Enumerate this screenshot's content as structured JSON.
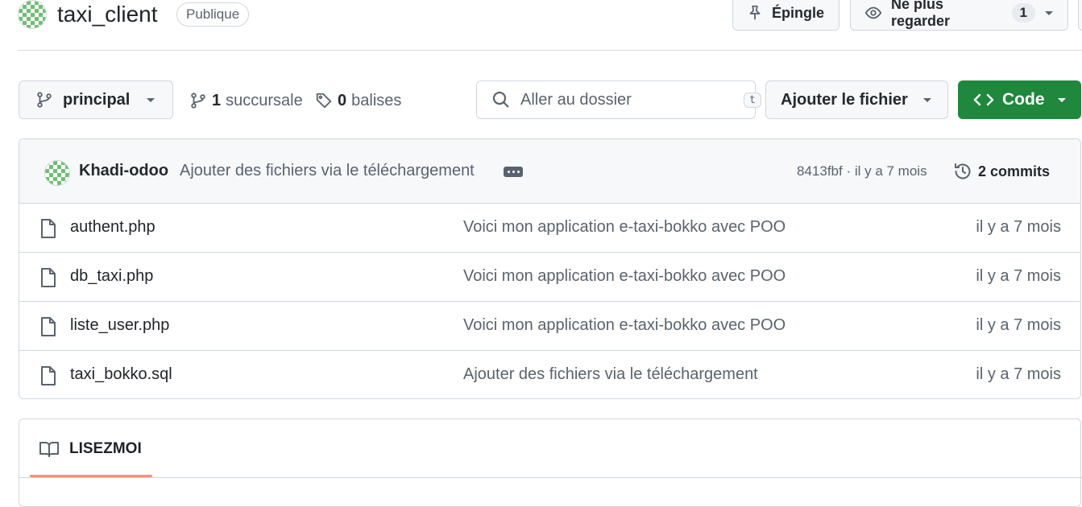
{
  "repo": {
    "name": "taxi_client",
    "visibility": "Publique"
  },
  "actions": {
    "pin_label": "Épingle",
    "watch_label": "Ne plus regarder",
    "watch_count": "1"
  },
  "toolbar": {
    "branch": "principal",
    "branches_count": "1",
    "branches_label": "succursale",
    "tags_count": "0",
    "tags_label": "balises",
    "search_placeholder": "Aller au dossier",
    "search_shortcut": "t",
    "add_file_label": "Ajouter le fichier",
    "code_label": "Code"
  },
  "commit": {
    "author": "Khadi-odoo",
    "message": "Ajouter des fichiers via le téléchargement",
    "hash_age": "8413fbf · il y a 7 mois",
    "commits_count": "2 commits"
  },
  "files": [
    {
      "name": "authent.php",
      "message": "Voici mon application e-taxi-bokko avec POO",
      "age": "il y a 7 mois"
    },
    {
      "name": "db_taxi.php",
      "message": "Voici mon application e-taxi-bokko avec POO",
      "age": "il y a 7 mois"
    },
    {
      "name": "liste_user.php",
      "message": "Voici mon application e-taxi-bokko avec POO",
      "age": "il y a 7 mois"
    },
    {
      "name": "taxi_bokko.sql",
      "message": "Ajouter des fichiers via le téléchargement",
      "age": "il y a 7 mois"
    }
  ],
  "readme": {
    "tab_label": "LISEZMOI"
  },
  "colors": {
    "primary_button": "#1f883d",
    "readme_underline": "#fd8c73",
    "avatar_green": "#6cc070"
  },
  "icons": {
    "branch": "git-branch-icon",
    "tag": "tag-icon",
    "search": "search-icon",
    "pin": "pin-icon",
    "eye": "eye-icon",
    "code": "code-icon",
    "history": "history-icon",
    "file": "file-icon",
    "book": "book-icon"
  }
}
